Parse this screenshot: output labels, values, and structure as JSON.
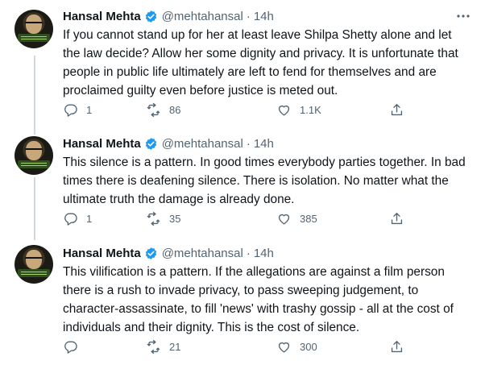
{
  "tweets": [
    {
      "name": "Hansal Mehta",
      "handle": "@mehtahansal",
      "separator": "·",
      "time": "14h",
      "text": "If you cannot stand up for her at least leave Shilpa Shetty alone and let the law decide? Allow her some dignity and privacy. It is unfortunate that people in public life ultimately are left to fend for themselves and are proclaimed guilty even before justice is meted out.",
      "replies": "1",
      "retweets": "86",
      "likes": "1.1K"
    },
    {
      "name": "Hansal Mehta",
      "handle": "@mehtahansal",
      "separator": "·",
      "time": "14h",
      "text": "This silence is a pattern. In good times everybody parties together. In bad times there is deafening silence. There is isolation. No matter what the ultimate truth the damage is  already done.",
      "replies": "1",
      "retweets": "35",
      "likes": "385"
    },
    {
      "name": "Hansal Mehta",
      "handle": "@mehtahansal",
      "separator": "·",
      "time": "14h",
      "text": "This vilification is a pattern. If the allegations are against a film person there is a rush to invade privacy, to pass sweeping judgement, to character-assassinate, to fill 'news' with trashy gossip - all at the cost of individuals and their dignity. This is the cost of silence.",
      "replies": "",
      "retweets": "21",
      "likes": "300"
    }
  ],
  "colors": {
    "text": "#0f1419",
    "muted": "#536471",
    "verified": "#1d9bf0",
    "thread_line": "#cfd9de"
  },
  "icons": [
    "verified-badge-icon",
    "more-options-icon",
    "reply-icon",
    "retweet-icon",
    "like-icon",
    "share-icon"
  ]
}
